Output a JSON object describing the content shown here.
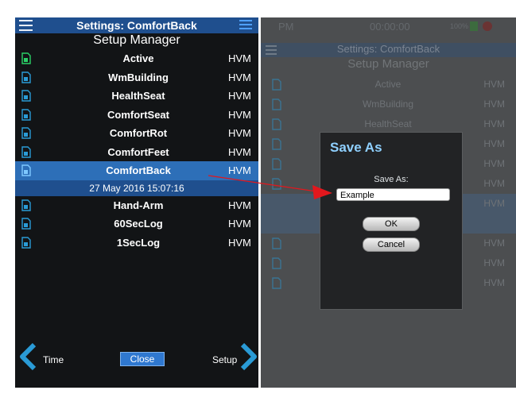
{
  "left": {
    "header_title": "Settings: ComfortBack",
    "subtitle": "Setup Manager",
    "rows": [
      {
        "name": "Active",
        "type": "HVM"
      },
      {
        "name": "WmBuilding",
        "type": "HVM"
      },
      {
        "name": "HealthSeat",
        "type": "HVM"
      },
      {
        "name": "ComfortSeat",
        "type": "HVM"
      },
      {
        "name": "ComfortRot",
        "type": "HVM"
      },
      {
        "name": "ComfortFeet",
        "type": "HVM"
      },
      {
        "name": "ComfortBack",
        "type": "HVM"
      },
      {
        "name": "Hand-Arm",
        "type": "HVM"
      },
      {
        "name": "60SecLog",
        "type": "HVM"
      },
      {
        "name": "1SecLog",
        "type": "HVM"
      }
    ],
    "selected_date": "27 May 2016 15:07:16",
    "footer": {
      "time_label": "Time",
      "close_label": "Close",
      "setup_label": "Setup"
    }
  },
  "right": {
    "status_left": "PM",
    "status_time": "00:00:00",
    "status_battery": "100%",
    "header_title": "Settings: ComfortBack",
    "subtitle": "Setup Manager",
    "rows": [
      {
        "name": "Active",
        "type": "HVM"
      },
      {
        "name": "WmBuilding",
        "type": "HVM"
      },
      {
        "name": "HealthSeat",
        "type": "HVM"
      },
      {
        "name": "",
        "type": "HVM"
      },
      {
        "name": "",
        "type": "HVM"
      },
      {
        "name": "",
        "type": "HVM"
      },
      {
        "name": "",
        "type": "HVM"
      },
      {
        "name": "",
        "type": ""
      },
      {
        "name": "",
        "type": "HVM"
      },
      {
        "name": "",
        "type": "HVM"
      },
      {
        "name": "",
        "type": "HVM"
      }
    ]
  },
  "dialog": {
    "title": "Save As",
    "label": "Save As:",
    "input_value": "Example",
    "ok_label": "OK",
    "cancel_label": "Cancel"
  },
  "colors": {
    "header_blue": "#1f4f8e",
    "selected_blue": "#2d6fb8",
    "accent_cyan": "#2a9bd6",
    "file_icon_green": "#2bd067",
    "arrow_red": "#e3171d",
    "dialog_title": "#8fd0ff"
  }
}
